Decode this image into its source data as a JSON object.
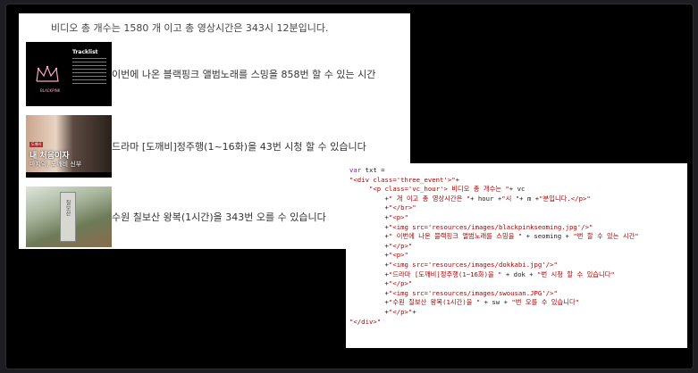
{
  "result": {
    "header": "비디오 총 개수는 1580 개 이고 총 영상시간은 343시 12분입니다.",
    "items": [
      {
        "caption": "이번에 나온 블랙핑크 앨범노래를 스밍을 858번 할 수 있는 시간",
        "thumb": {
          "title": "Tracklist",
          "logo": "BLACKPINK"
        }
      },
      {
        "caption": "드라마 [도깨비]정주행(1~16화)을 43번 시청 할 수 있습니다",
        "thumb": {
          "tag": "도깨비",
          "sub1": "내 처음이자",
          "sub2": "마지막, 도깨비 신부"
        }
      },
      {
        "caption": "수원 칠보산 왕복(1시간)을 343번 오를 수 있습니다",
        "thumb": {
          "stone_text": "칠보산"
        }
      }
    ]
  },
  "code": {
    "lines": [
      [
        {
          "t": "var",
          "c": "kw"
        },
        {
          "t": " txt = "
        }
      ],
      [
        {
          "t": "\"<div class='three_event'>\"",
          "c": "str"
        },
        {
          "t": "+"
        }
      ],
      [
        {
          "t": "     "
        },
        {
          "t": "\"<p class='vc_hour'> 비디오 총 개수는 \"",
          "c": "str"
        },
        {
          "t": "+ vc"
        }
      ],
      [
        {
          "t": "         +"
        },
        {
          "t": "\" 개 이고 총 영상시간은 \"",
          "c": "str"
        },
        {
          "t": "+ hour +"
        },
        {
          "t": "\"시 \"",
          "c": "str"
        },
        {
          "t": "+ m +"
        },
        {
          "t": "\"분입니다.</p>\"",
          "c": "str"
        }
      ],
      [
        {
          "t": "         +"
        },
        {
          "t": "\"</br>\"",
          "c": "str"
        }
      ],
      [
        {
          "t": "         +"
        },
        {
          "t": "\"<p>\"",
          "c": "str"
        }
      ],
      [
        {
          "t": "         +"
        },
        {
          "t": "\"<img src='resources/images/blackpinkseoming.jpg'/>\"",
          "c": "str"
        }
      ],
      [
        {
          "t": "         +"
        },
        {
          "t": "\" 이번에 나온 블랙핑크 앨범노래를 스밍을 \"",
          "c": "str"
        },
        {
          "t": " + seoming + "
        },
        {
          "t": "\"번 할 수 있는 시간\"",
          "c": "str"
        }
      ],
      [
        {
          "t": "         +"
        },
        {
          "t": "\"</p>\"",
          "c": "str"
        }
      ],
      [
        {
          "t": "         +"
        },
        {
          "t": "\"<p>\"",
          "c": "str"
        }
      ],
      [
        {
          "t": "         +"
        },
        {
          "t": "\"<img src='resources/images/dokkabi.jpg'/>\"",
          "c": "str"
        }
      ],
      [
        {
          "t": "         +"
        },
        {
          "t": "\"드라마 [도깨비]정주행(1~16화)을 \"",
          "c": "str"
        },
        {
          "t": " + dok + "
        },
        {
          "t": "\"번 시청 할 수 있습니다\"",
          "c": "str"
        }
      ],
      [
        {
          "t": "         +"
        },
        {
          "t": "\"</p>\"",
          "c": "str"
        }
      ],
      [
        {
          "t": "         +"
        },
        {
          "t": "\"<img src='resources/images/swousan.JPG'/>\"",
          "c": "str"
        }
      ],
      [
        {
          "t": "         +"
        },
        {
          "t": "\"수원 칠보산 왕복(1시간)을 \"",
          "c": "str"
        },
        {
          "t": " + sw + "
        },
        {
          "t": "\"번 오를 수 있습니다\"",
          "c": "str"
        }
      ],
      [
        {
          "t": "         +"
        },
        {
          "t": "\"</p>\"",
          "c": "str"
        },
        {
          "t": "+"
        }
      ],
      [
        {
          "t": "\"</div>\"",
          "c": "str"
        }
      ]
    ]
  }
}
